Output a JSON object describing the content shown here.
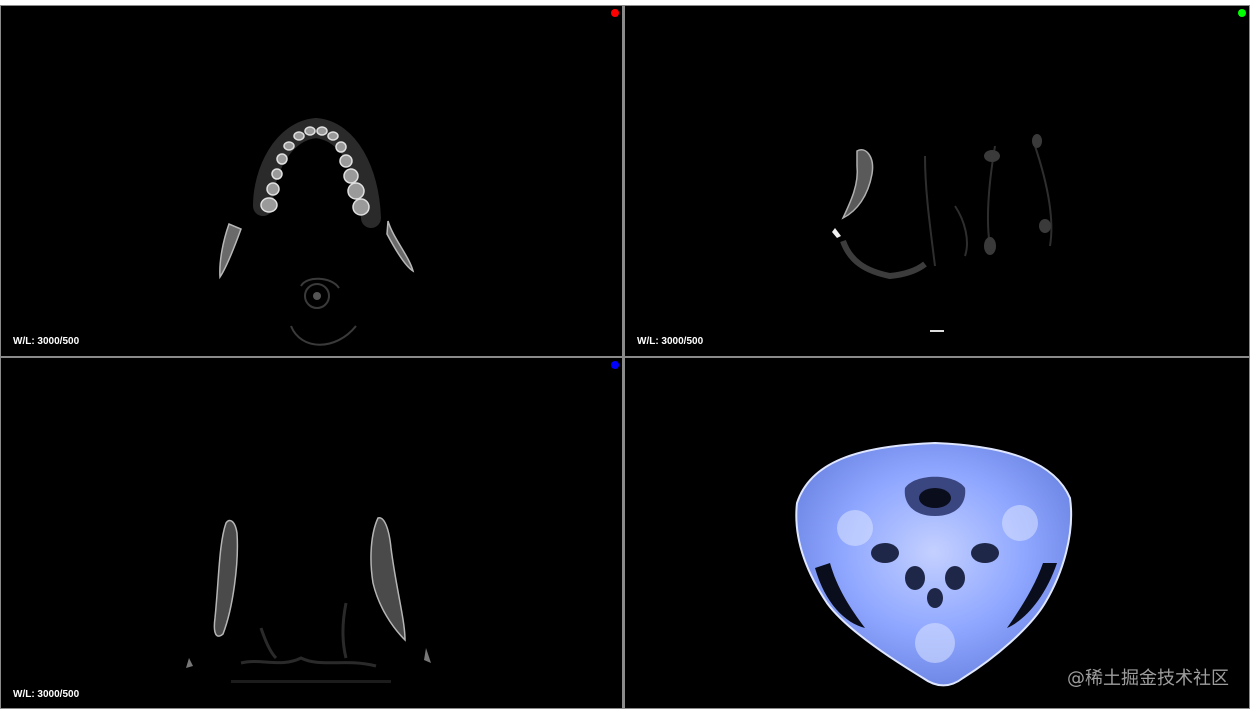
{
  "viewports": [
    {
      "id": "axial",
      "wl_label": "W/L: 3000/500",
      "dot_color": "#ff0000"
    },
    {
      "id": "sagittal",
      "wl_label": "W/L: 3000/500",
      "dot_color": "#00ff00"
    },
    {
      "id": "coronal",
      "wl_label": "W/L: 3000/500",
      "dot_color": "#0000ff"
    },
    {
      "id": "volume",
      "render_tint": "#8fa7ff"
    }
  ],
  "watermark": "@稀土掘金技术社区"
}
